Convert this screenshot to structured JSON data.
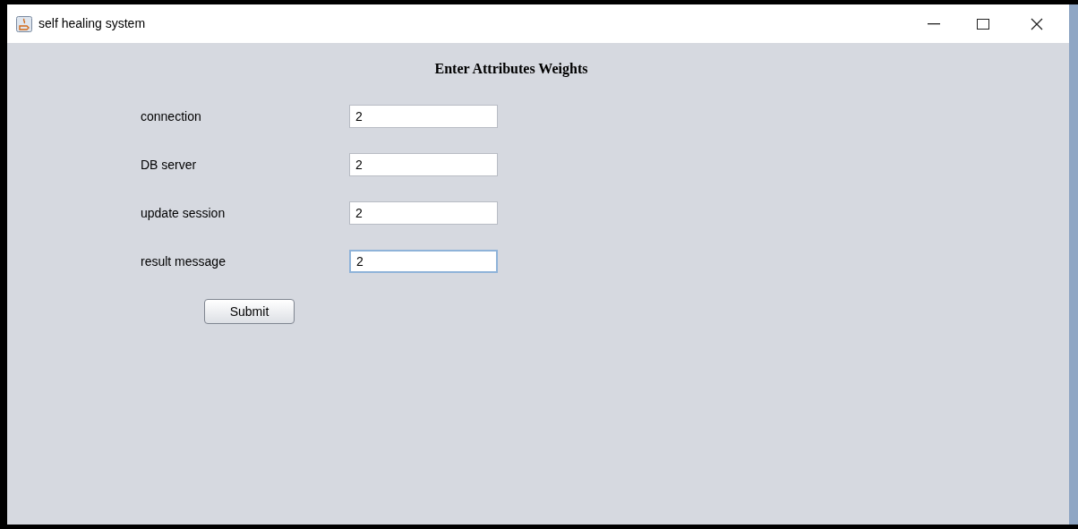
{
  "window": {
    "title": "self healing system"
  },
  "heading": "Enter Attributes Weights",
  "fields": [
    {
      "label": "connection",
      "value": "2",
      "focused": false
    },
    {
      "label": "DB server",
      "value": "2",
      "focused": false
    },
    {
      "label": "update session",
      "value": "2",
      "focused": false
    },
    {
      "label": "result message",
      "value": "2",
      "focused": true
    }
  ],
  "buttons": [
    "Submit"
  ]
}
